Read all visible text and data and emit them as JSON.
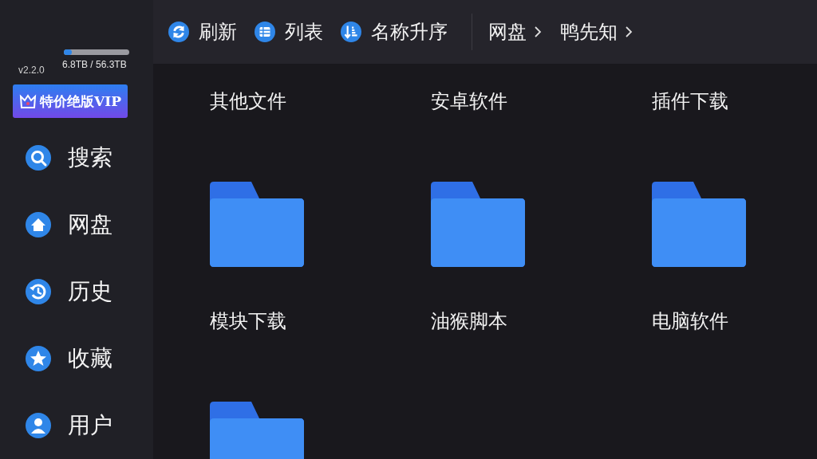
{
  "sidebar": {
    "storage": {
      "level": 0.12,
      "text": "6.8TB / 56.3TB"
    },
    "version": "v2.2.0",
    "vip_button": "特价绝版VIP",
    "nav": [
      {
        "label": "搜索",
        "kind": "search"
      },
      {
        "label": "网盘",
        "kind": "home"
      },
      {
        "label": "历史",
        "kind": "history"
      },
      {
        "label": "收藏",
        "kind": "star"
      },
      {
        "label": "用户",
        "kind": "user"
      }
    ]
  },
  "toolbar": {
    "actions": [
      {
        "label": "刷新",
        "kind": "refresh"
      },
      {
        "label": "列表",
        "kind": "list"
      },
      {
        "label": "名称升序",
        "kind": "sort"
      }
    ],
    "breadcrumb": [
      "网盘",
      "鸭先知"
    ]
  },
  "files": [
    {
      "name": "其他文件",
      "folder_shown": false
    },
    {
      "name": "安卓软件",
      "folder_shown": false
    },
    {
      "name": "插件下载",
      "folder_shown": false
    },
    {
      "name": "模块下载",
      "folder_shown": true
    },
    {
      "name": "油猴脚本",
      "folder_shown": true
    },
    {
      "name": "电脑软件",
      "folder_shown": true
    },
    {
      "folder_shown": true
    }
  ]
}
